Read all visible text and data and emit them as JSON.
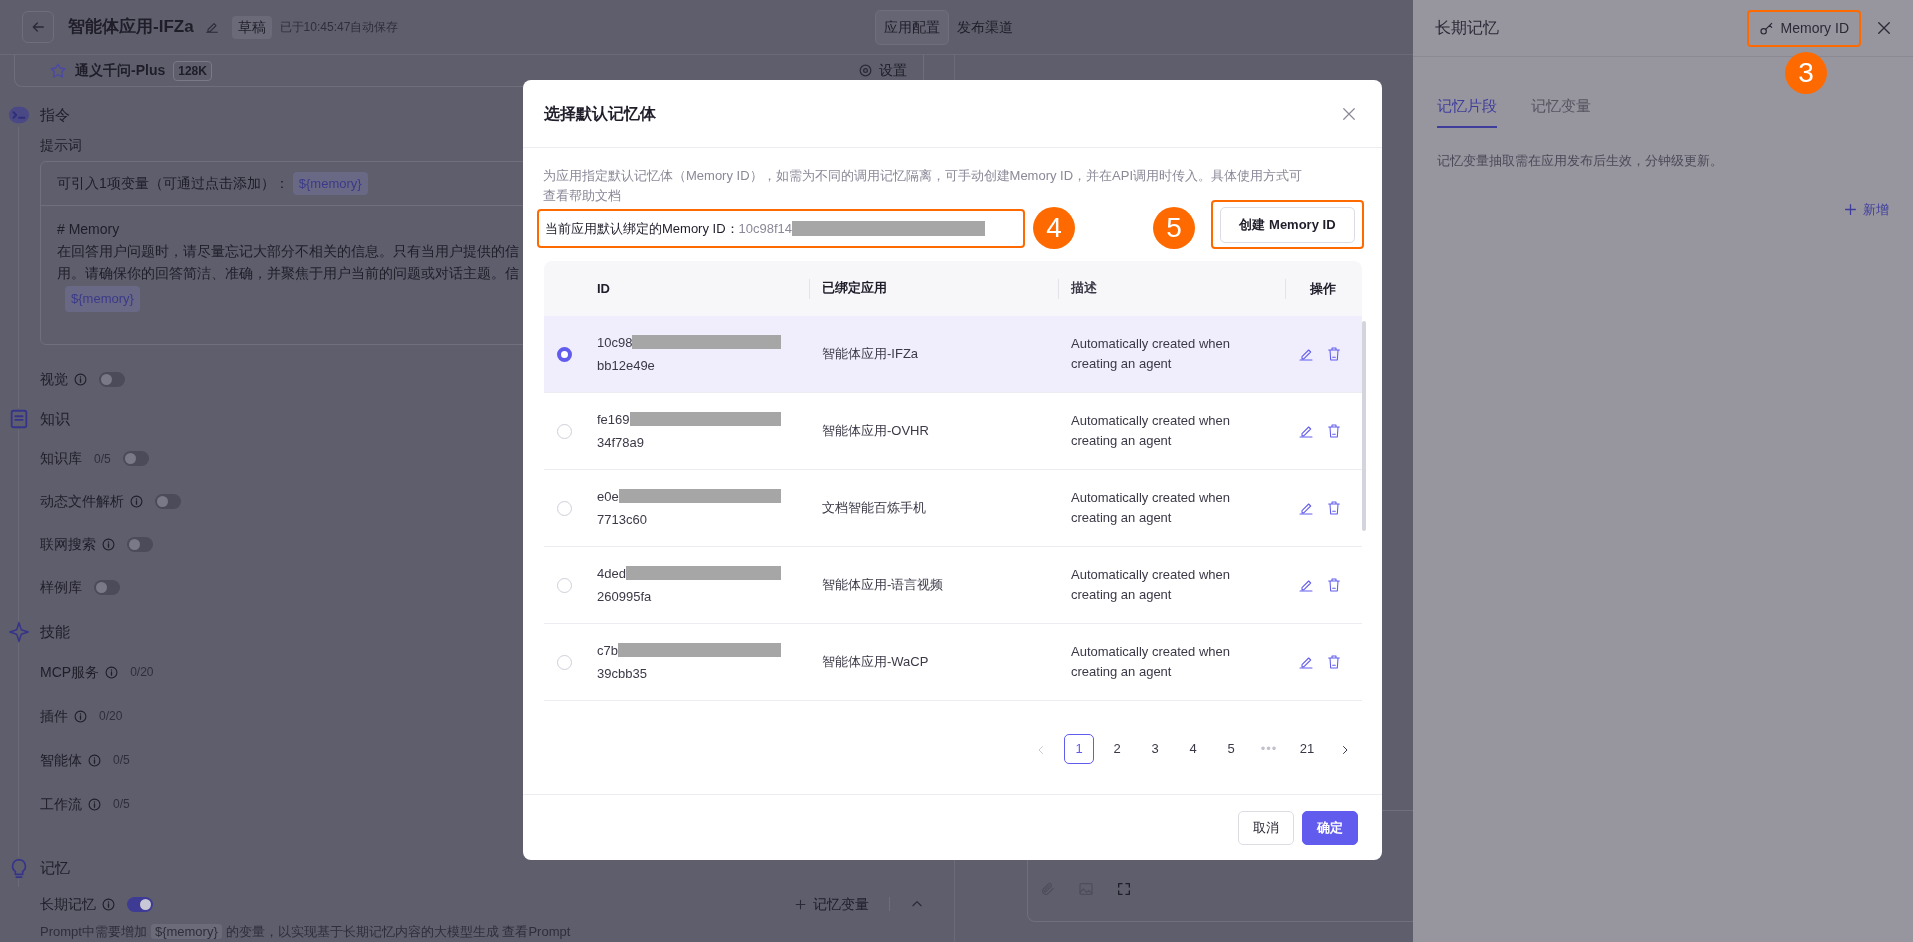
{
  "header": {
    "title": "智能体应用-IFZa",
    "tag": "草稿",
    "autosave": "已于10:45:47自动保存",
    "tabs": [
      {
        "label": "应用配置",
        "selected": true
      },
      {
        "label": "发布渠道",
        "selected": false
      }
    ]
  },
  "model": {
    "name": "通义千问-Plus",
    "context": "128K",
    "settings": "设置"
  },
  "sections": [
    {
      "title": "指令",
      "prompt": {
        "label": "提示词",
        "variable_hint": "可引入1项变量（可通过点击添加）：",
        "variable": "${memory}",
        "lines": [
          "# Memory",
          "在回答用户问题时，请尽量忘记大部分不相关的信息。只有当用户提供的信",
          "用。请确保你的回答简洁、准确，并聚焦于用户当前的问题或对话主题。信"
        ],
        "line_variable": "${memory}"
      },
      "items": [
        {
          "label": "视觉",
          "info": true,
          "kind": "toggle",
          "on": false
        }
      ]
    },
    {
      "title": "知识",
      "items": [
        {
          "label": "知识库",
          "info": false,
          "count": "0/5",
          "kind": "toggle",
          "on": false
        },
        {
          "label": "动态文件解析",
          "info": true,
          "kind": "toggle",
          "on": false
        },
        {
          "label": "联网搜索",
          "info": true,
          "kind": "toggle",
          "on": false
        },
        {
          "label": "样例库",
          "info": false,
          "kind": "toggle",
          "on": false
        }
      ]
    },
    {
      "title": "技能",
      "items": [
        {
          "label": "MCP服务",
          "info": true,
          "count": "0/20",
          "kind": "count"
        },
        {
          "label": "插件",
          "info": true,
          "count": "0/20",
          "kind": "count"
        },
        {
          "label": "智能体",
          "info": true,
          "count": "0/5",
          "kind": "count"
        },
        {
          "label": "工作流",
          "info": true,
          "count": "0/5",
          "kind": "count"
        }
      ]
    },
    {
      "title": "记忆",
      "items": [
        {
          "label": "长期记忆",
          "info": true,
          "kind": "toggle",
          "on": true,
          "action": "记忆变量"
        }
      ],
      "note": {
        "prefix": "Prompt中需要增加",
        "variable": "${memory}",
        "suffix": "的变量，以实现基于长期记忆内容的大模型生成",
        "link": "查看Prompt"
      }
    }
  ],
  "dialog": {
    "title": "选择默认记忆体",
    "description": "为应用指定默认记忆体（Memory ID），如需为不同的调用记忆隔离，可手动创建Memory ID，并在API调用时传入。具体使用方式可",
    "help_prefix": "查看",
    "help_link": "帮助文档",
    "current": {
      "label": "当前应用默认绑定的Memory ID：",
      "value": "10c98f14",
      "highlighted": true,
      "badge": "4"
    },
    "create": {
      "label": "创建 Memory ID",
      "highlighted": true,
      "badge": "5"
    },
    "columns": [
      "ID",
      "已绑定应用",
      "描述",
      "操作"
    ],
    "rows": [
      {
        "id_head": "10c98",
        "id_tail": "bb12e49e",
        "app": "智能体应用-IFZa",
        "description": "Automatically created when creating an agent",
        "selected": true
      },
      {
        "id_head": "fe169",
        "id_tail": "34f78a9",
        "app": "智能体应用-OVHR",
        "description": "Automatically created when creating an agent",
        "selected": false
      },
      {
        "id_head": "e0e",
        "id_tail": "7713c60",
        "app": "文档智能百炼手机",
        "description": "Automatically created when creating an agent",
        "selected": false
      },
      {
        "id_head": "4ded",
        "id_tail": "260995fa",
        "app": "智能体应用-语言视频",
        "description": "Automatically created when creating an agent",
        "selected": false
      },
      {
        "id_head": "c7b",
        "id_tail": "39cbb35",
        "app": "智能体应用-WaCP",
        "description": "Automatically created when creating an agent",
        "selected": false
      }
    ],
    "prev": {
      "disabled": true
    },
    "next": {
      "disabled": false
    },
    "pages": [
      {
        "label": "1",
        "kind": "page",
        "selected": true
      },
      {
        "label": "2",
        "kind": "page",
        "selected": false
      },
      {
        "label": "3",
        "kind": "page",
        "selected": false
      },
      {
        "label": "4",
        "kind": "page",
        "selected": false
      },
      {
        "label": "5",
        "kind": "page",
        "selected": false
      },
      {
        "label": "•••",
        "kind": "ellipsis",
        "selected": false
      },
      {
        "label": "21",
        "kind": "page",
        "selected": false
      }
    ],
    "buttons": [
      {
        "label": "取消",
        "kind": "secondary"
      },
      {
        "label": "确定",
        "kind": "primary"
      }
    ]
  },
  "drawer": {
    "title": "长期记忆",
    "memory_button": {
      "label": "Memory ID",
      "highlighted": true,
      "badge": "3"
    },
    "tabs": [
      {
        "label": "记忆片段",
        "selected": true
      },
      {
        "label": "记忆变量",
        "selected": false
      }
    ],
    "hint": "记忆变量抽取需在应用发布后生效，分钟级更新。",
    "add": "新增"
  }
}
